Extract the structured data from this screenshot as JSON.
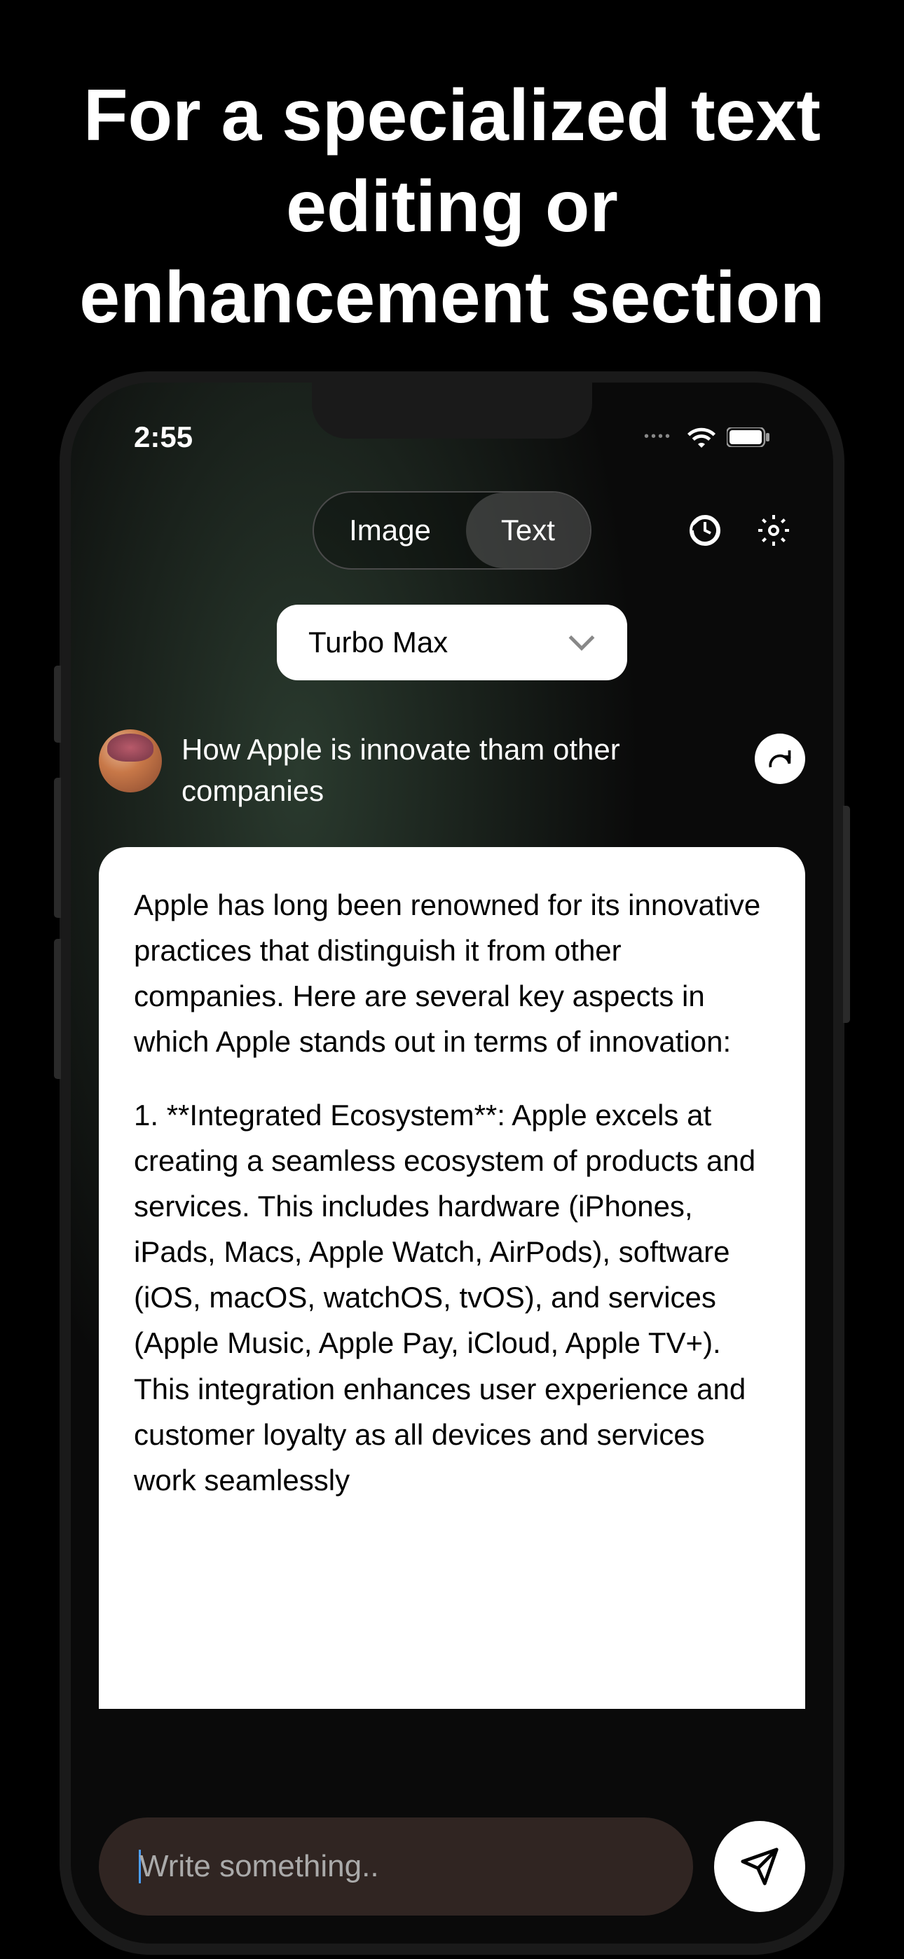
{
  "promo": {
    "title": "For a specialized text editing or enhancement section"
  },
  "statusBar": {
    "time": "2:55"
  },
  "modeToggle": {
    "image": "Image",
    "text": "Text",
    "active": "text"
  },
  "modelSelect": {
    "value": "Turbo Max"
  },
  "userMessage": {
    "text": "How Apple is innovate tham other companies"
  },
  "responseMessage": {
    "para1": "Apple has long been renowned for its innovative practices that distinguish it from other companies. Here are several key aspects in which Apple stands out in terms of innovation:",
    "para2": "1. **Integrated Ecosystem**: Apple excels at creating a seamless ecosystem of products and services. This includes hardware (iPhones, iPads, Macs, Apple Watch, AirPods), software (iOS, macOS, watchOS, tvOS), and services (Apple Music, Apple Pay, iCloud, Apple TV+). This integration enhances user experience and customer loyalty as all devices and services work seamlessly"
  },
  "input": {
    "placeholder": "Write something.."
  }
}
